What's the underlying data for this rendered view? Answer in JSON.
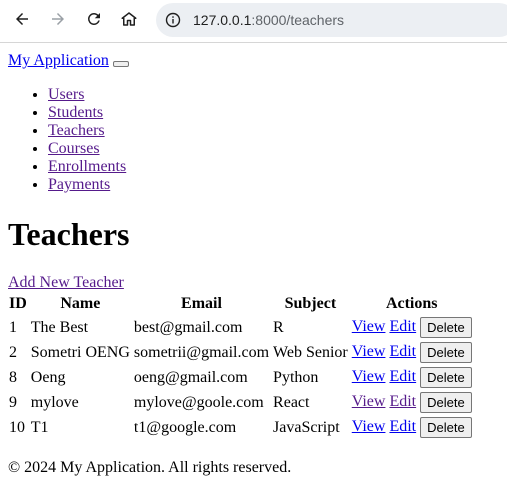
{
  "browser": {
    "url_host": "127.0.0.1",
    "url_rest": ":8000/teachers"
  },
  "navbar": {
    "brand": "My Application",
    "items": [
      {
        "label": "Users"
      },
      {
        "label": "Students"
      },
      {
        "label": "Teachers"
      },
      {
        "label": "Courses"
      },
      {
        "label": "Enrollments"
      },
      {
        "label": "Payments"
      }
    ]
  },
  "main": {
    "title": "Teachers",
    "add_link": "Add New Teacher",
    "table": {
      "headers": [
        "ID",
        "Name",
        "Email",
        "Subject",
        "Actions"
      ],
      "rows": [
        {
          "id": "1",
          "name": "The Best",
          "email": "best@gmail.com",
          "subject": "R"
        },
        {
          "id": "2",
          "name": "Sometri OENG",
          "email": "sometrii@gmail.com",
          "subject": "Web Senior"
        },
        {
          "id": "8",
          "name": "Oeng",
          "email": "oeng@gmail.com",
          "subject": "Python"
        },
        {
          "id": "9",
          "name": "mylove",
          "email": "mylove@goole.com",
          "subject": "React"
        },
        {
          "id": "10",
          "name": "T1",
          "email": "t1@google.com",
          "subject": "JavaScript"
        }
      ],
      "view_label": "View",
      "edit_label": "Edit",
      "delete_label": "Delete"
    }
  },
  "footer": {
    "text": "© 2024 My Application. All rights reserved."
  },
  "colors": {
    "link": "#0000ee",
    "visited_link": "#551a8b"
  }
}
